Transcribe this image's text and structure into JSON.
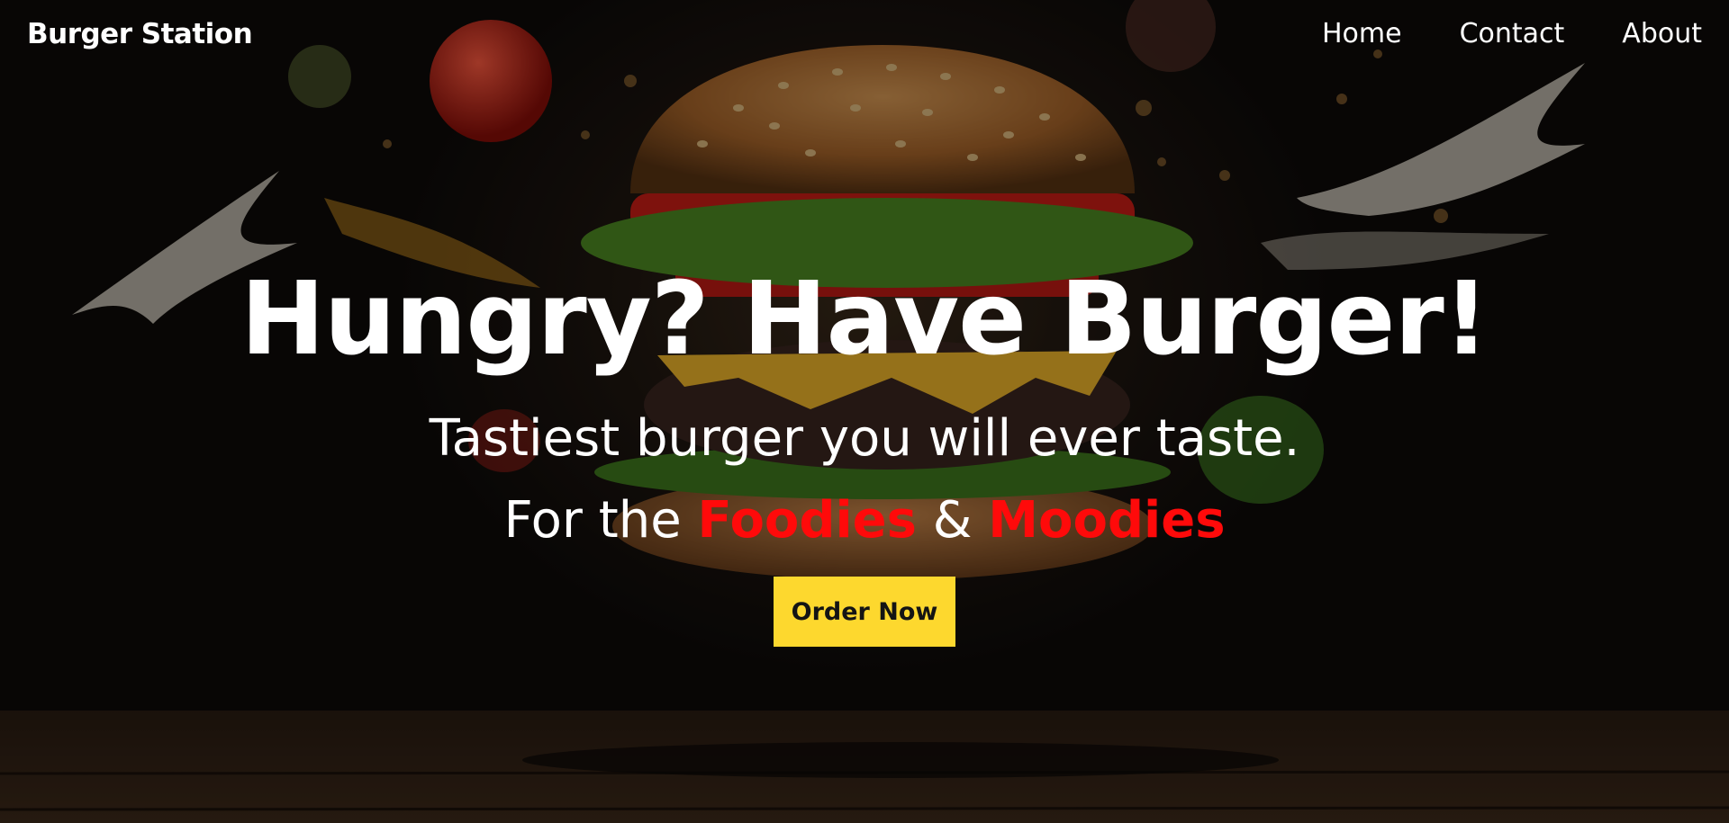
{
  "brand": {
    "name": "Burger Station"
  },
  "nav": {
    "links": [
      {
        "label": "Home"
      },
      {
        "label": "Contact"
      },
      {
        "label": "About"
      }
    ]
  },
  "hero": {
    "headline": "Hungry? Have Burger!",
    "tagline": "Tastiest burger you will ever taste.",
    "subline": {
      "prefix": "For the ",
      "accent1": "Foodies",
      "middle": " & ",
      "accent2": "Moodies"
    },
    "cta_label": "Order Now",
    "background_image": "burger-photo"
  },
  "colors": {
    "accent_red": "#ff0a0a",
    "button_yellow": "#fdd82e",
    "text_white": "#ffffff"
  }
}
